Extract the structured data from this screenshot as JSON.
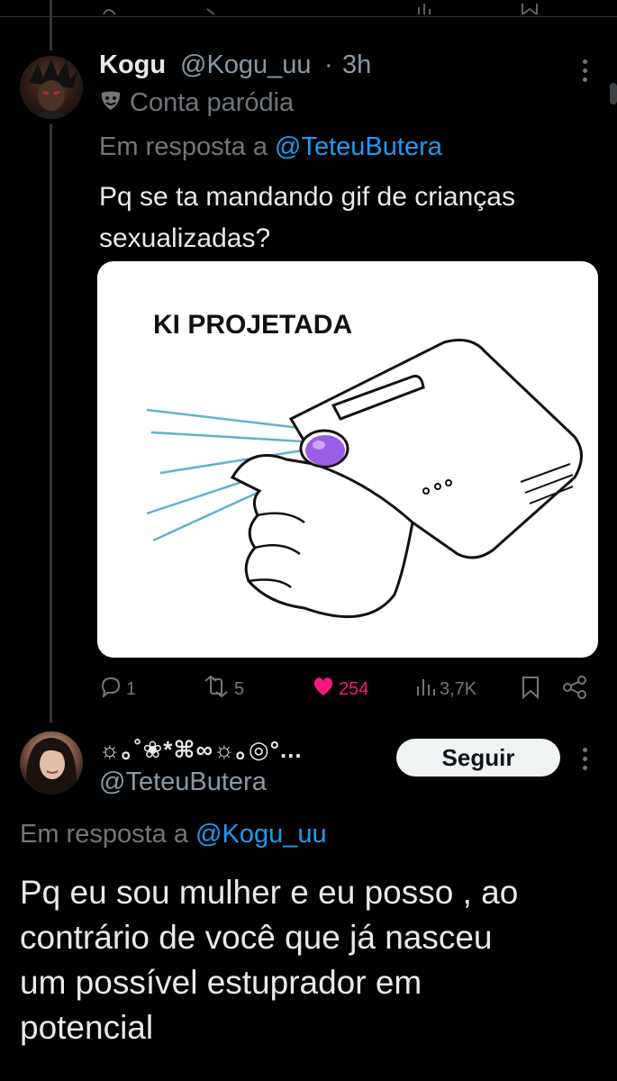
{
  "tweet1": {
    "name": "Kogu",
    "handle": "@Kogu_uu",
    "separator": "·",
    "time": "3h",
    "badge_label": "Conta paródia",
    "reply_prefix": "Em resposta a",
    "reply_to": "@TeteuButera",
    "text_line1": "Pq se ta mandando gif de crianças",
    "text_line2": "sexualizadas?",
    "media": {
      "caption": "KI PROJETADA"
    },
    "stats": {
      "replies": "1",
      "retweets": "5",
      "likes": "254",
      "views": "3,7K"
    }
  },
  "tweet2": {
    "display_name": "☼｡˚❀*⌘∞☼｡◎°...",
    "handle": "@TeteuButera",
    "follow_label": "Seguir",
    "reply_prefix": "Em resposta a",
    "reply_to": "@Kogu_uu",
    "text_line1": "Pq eu sou mulher e eu posso , ao",
    "text_line2": "contrário de você que já nasceu",
    "text_line3": "um possível estuprador em",
    "text_line4": "potencial"
  },
  "colors": {
    "background": "#000000",
    "text": "#e7e9ea",
    "muted": "#71767b",
    "link": "#1d9bf0",
    "like": "#f91880",
    "projector_lens": "#9b5de5",
    "beam": "#5fb4c8"
  },
  "icons": [
    "theater-masks-icon",
    "more-icon",
    "reply-icon",
    "retweet-icon",
    "heart-icon",
    "views-icon",
    "bookmark-icon",
    "share-icon"
  ]
}
